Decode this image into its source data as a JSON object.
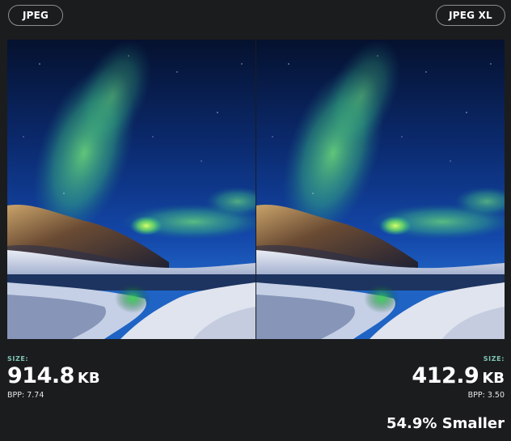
{
  "buttons": {
    "left_format": "JPEG",
    "right_format": "JPEG XL"
  },
  "left": {
    "size_label": "SIZE:",
    "size_value": "914.8",
    "size_unit": "KB",
    "bpp_label": "BPP:",
    "bpp_value": "7.74"
  },
  "right": {
    "size_label": "SIZE:",
    "size_value": "412.9",
    "size_unit": "KB",
    "bpp_label": "BPP:",
    "bpp_value": "3.50"
  },
  "savings": "54.9% Smaller",
  "colors": {
    "background": "#1b1c1e",
    "button_border": "#8b8d91",
    "label_accent": "#7fc6b4",
    "text": "#ffffff"
  },
  "image_subject": "aurora-over-snowy-coast"
}
